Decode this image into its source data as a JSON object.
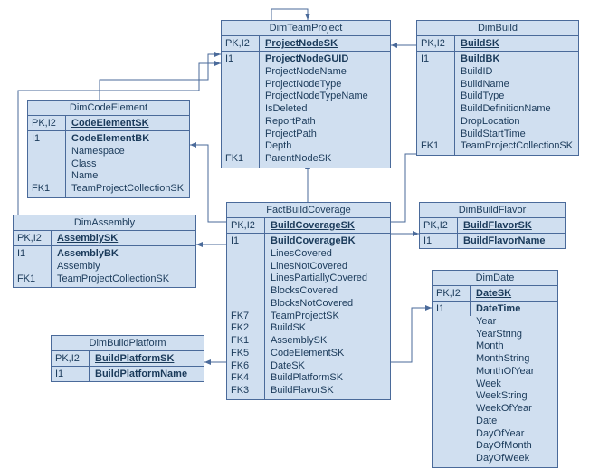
{
  "entities": {
    "dimTeamProject": {
      "title": "DimTeamProject",
      "pkLabel": "PK,I2",
      "pkField": "ProjectNodeSK",
      "secKey": "I1",
      "attrs": [
        "ProjectNodeGUID",
        "ProjectNodeName",
        "ProjectNodeType",
        "ProjectNodeTypeName",
        "IsDeleted",
        "ReportPath",
        "ProjectPath",
        "Depth",
        "ParentNodeSK"
      ],
      "fkLabel": "FK1"
    },
    "dimBuild": {
      "title": "DimBuild",
      "pkLabel": "PK,I2",
      "pkField": "BuildSK",
      "secKey": "I1",
      "attrs": [
        "BuildBK",
        "BuildID",
        "BuildName",
        "BuildType",
        "BuildDefinitionName",
        "DropLocation",
        "BuildStartTime",
        "TeamProjectCollectionSK"
      ],
      "fkLabel": "FK1"
    },
    "dimCodeElement": {
      "title": "DimCodeElement",
      "pkLabel": "PK,I2",
      "pkField": "CodeElementSK",
      "secKey": "I1",
      "attrs": [
        "CodeElementBK",
        "Namespace",
        "Class",
        "Name",
        "TeamProjectCollectionSK"
      ],
      "fkLabel": "FK1"
    },
    "dimAssembly": {
      "title": "DimAssembly",
      "pkLabel": "PK,I2",
      "pkField": "AssemblySK",
      "secKey": "I1",
      "attrs": [
        "AssemblyBK",
        "Assembly",
        "TeamProjectCollectionSK"
      ],
      "fkLabel": "FK1"
    },
    "factBuildCoverage": {
      "title": "FactBuildCoverage",
      "pkLabel": "PK,I2",
      "pkField": "BuildCoverageSK",
      "secKey": "I1",
      "attrs": [
        "BuildCoverageBK",
        "LinesCovered",
        "LinesNotCovered",
        "LinesPartiallyCovered",
        "BlocksCovered",
        "BlocksNotCovered",
        "TeamProjectSK",
        "BuildSK",
        "AssemblySK",
        "CodeElementSK",
        "DateSK",
        "BuildPlatformSK",
        "BuildFlavorSK"
      ],
      "fkLabels": [
        "",
        "",
        "",
        "",
        "",
        "",
        "FK7",
        "FK2",
        "FK1",
        "FK5",
        "FK6",
        "FK4",
        "FK3"
      ]
    },
    "dimBuildFlavor": {
      "title": "DimBuildFlavor",
      "pkLabel": "PK,I2",
      "pkField": "BuildFlavorSK",
      "secKey": "I1",
      "attrs": [
        "BuildFlavorName"
      ]
    },
    "dimDate": {
      "title": "DimDate",
      "pkLabel": "PK,I2",
      "pkField": "DateSK",
      "secKey": "I1",
      "attrs": [
        "DateTime",
        "Year",
        "YearString",
        "Month",
        "MonthString",
        "MonthOfYear",
        "Week",
        "WeekString",
        "WeekOfYear",
        "Date",
        "DayOfYear",
        "DayOfMonth",
        "DayOfWeek"
      ]
    },
    "dimBuildPlatform": {
      "title": "DimBuildPlatform",
      "pkLabel": "PK,I2",
      "pkField": "BuildPlatformSK",
      "secKey": "I1",
      "attrs": [
        "BuildPlatformName"
      ]
    }
  }
}
